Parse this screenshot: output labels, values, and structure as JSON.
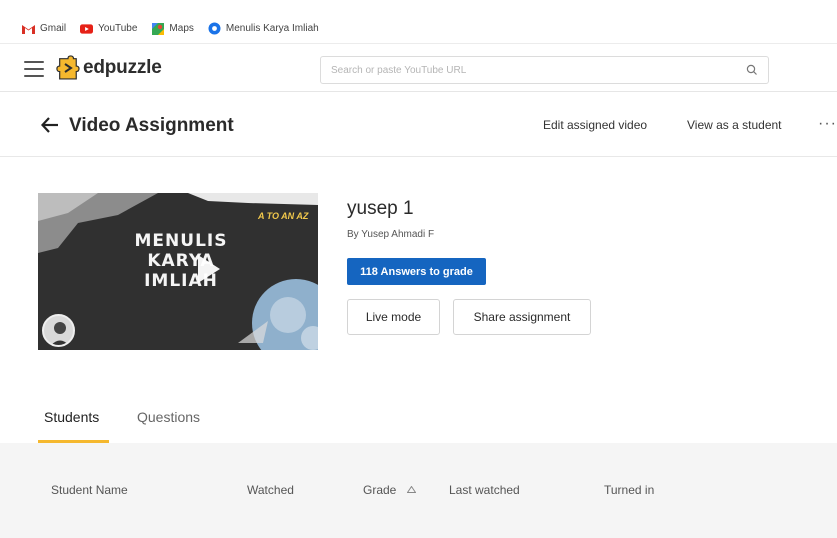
{
  "bookmarks": [
    {
      "label": "Gmail",
      "icon": "gmail-icon"
    },
    {
      "label": "YouTube",
      "icon": "youtube-icon"
    },
    {
      "label": "Maps",
      "icon": "maps-icon"
    },
    {
      "label": "Menulis Karya Imliah",
      "icon": "globe-icon"
    }
  ],
  "appbar": {
    "logo_text": "edpuzzle",
    "search_placeholder": "Search or paste YouTube URL"
  },
  "page": {
    "title": "Video Assignment",
    "edit_link": "Edit assigned video",
    "view_link": "View as a student",
    "more": "···"
  },
  "video": {
    "thumb_title_line1": "MENULIS",
    "thumb_title_line2": "KARYA",
    "thumb_title_line3": "IMLIAH",
    "thumb_tag": "A TO AN AZ",
    "name": "yusep 1",
    "author": "By Yusep Ahmadi F"
  },
  "actions": {
    "grade_button": "118 Answers to grade",
    "live_mode": "Live mode",
    "share": "Share assignment"
  },
  "tabs": [
    {
      "label": "Students",
      "active": true
    },
    {
      "label": "Questions",
      "active": false
    }
  ],
  "table": {
    "columns": [
      "Student Name",
      "Watched",
      "Grade",
      "Last watched",
      "Turned in"
    ]
  },
  "colors": {
    "primary": "#1565c0",
    "tab_accent": "#f5b82e",
    "logo_yellow": "#f5b82e"
  }
}
